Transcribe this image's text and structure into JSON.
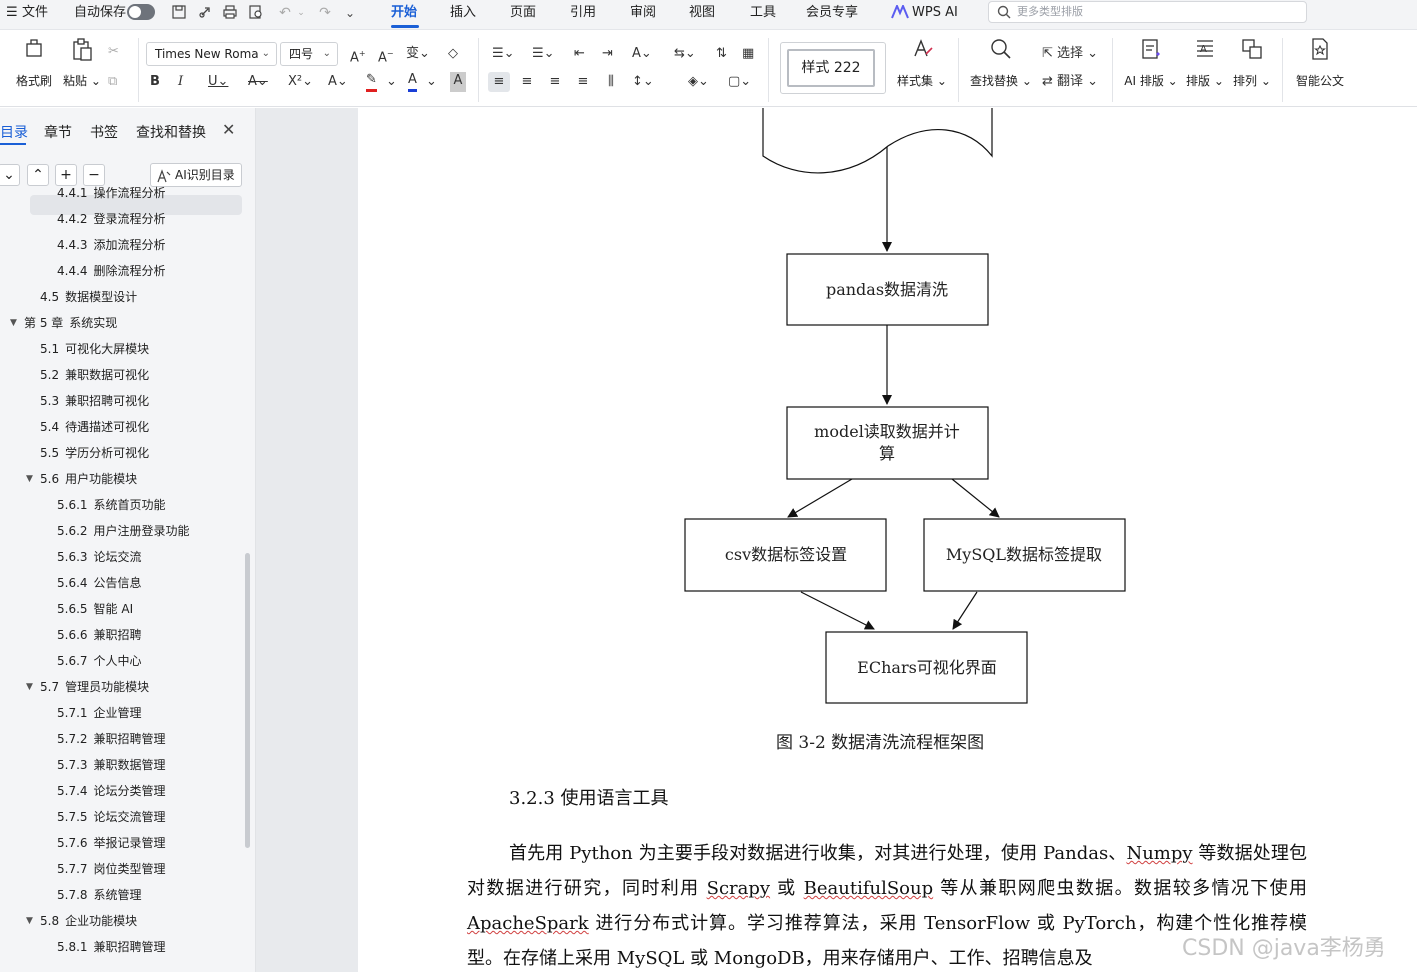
{
  "menubar": {
    "menu_label": "文件",
    "autosave_label": "自动保存",
    "tabs": [
      "开始",
      "插入",
      "页面",
      "引用",
      "审阅",
      "视图",
      "工具",
      "会员专享"
    ],
    "wps_ai": "WPS AI",
    "search_placeholder": "更多类型排版"
  },
  "ribbon": {
    "format_painter": "格式刷",
    "paste": "粘贴",
    "font_name": "Times New Roma",
    "font_size": "四号",
    "style_name": "样式 222",
    "styles_set": "样式集",
    "find_replace": "查找替换",
    "select": "选择",
    "translate": "翻译",
    "ai_layout": "AI 排版",
    "layout": "排版",
    "arrange": "排列",
    "smart_doc": "智能公文"
  },
  "nav": {
    "tabs": [
      "目录",
      "章节",
      "书签",
      "查找和替换"
    ],
    "ai_toc_button": "AI识别目录",
    "items": [
      {
        "num": "4.4.1",
        "label": "操作流程分析"
      },
      {
        "num": "4.4.2",
        "label": "登录流程分析"
      },
      {
        "num": "4.4.3",
        "label": "添加流程分析"
      },
      {
        "num": "4.4.4",
        "label": "删除流程分析"
      },
      {
        "num": "4.5",
        "label": "数据模型设计"
      },
      {
        "num": "第 5 章",
        "label": "系统实现"
      },
      {
        "num": "5.1",
        "label": "可视化大屏模块"
      },
      {
        "num": "5.2",
        "label": "兼职数据可视化"
      },
      {
        "num": "5.3",
        "label": "兼职招聘可视化"
      },
      {
        "num": "5.4",
        "label": "待遇描述可视化"
      },
      {
        "num": "5.5",
        "label": "学历分析可视化"
      },
      {
        "num": "5.6",
        "label": "用户功能模块"
      },
      {
        "num": "5.6.1",
        "label": "系统首页功能"
      },
      {
        "num": "5.6.2",
        "label": "用户注册登录功能"
      },
      {
        "num": "5.6.3",
        "label": "论坛交流"
      },
      {
        "num": "5.6.4",
        "label": "公告信息"
      },
      {
        "num": "5.6.5",
        "label": "智能 AI"
      },
      {
        "num": "5.6.6",
        "label": "兼职招聘"
      },
      {
        "num": "5.6.7",
        "label": "个人中心"
      },
      {
        "num": "5.7",
        "label": "管理员功能模块"
      },
      {
        "num": "5.7.1",
        "label": "企业管理"
      },
      {
        "num": "5.7.2",
        "label": "兼职招聘管理"
      },
      {
        "num": "5.7.3",
        "label": "兼职数据管理"
      },
      {
        "num": "5.7.4",
        "label": "论坛分类管理"
      },
      {
        "num": "5.7.5",
        "label": "论坛交流管理"
      },
      {
        "num": "5.7.6",
        "label": "举报记录管理"
      },
      {
        "num": "5.7.7",
        "label": "岗位类型管理"
      },
      {
        "num": "5.7.8",
        "label": "系统管理"
      },
      {
        "num": "5.8",
        "label": "企业功能模块"
      },
      {
        "num": "5.8.1",
        "label": "兼职招聘管理"
      }
    ]
  },
  "document": {
    "flowchart": {
      "nodes": [
        "pandas数据清洗",
        "model读取数据并计",
        "算",
        "csv数据标签设置",
        "MySQL数据标签提取",
        "EChars可视化界面"
      ]
    },
    "caption": "图 3-2  数据清洗流程框架图",
    "heading": "3.2.3  使用语言工具",
    "paragraph": {
      "p1": "首先用 Python 为主要手段对数据进行收集，对其进行处理，使用 Pandas、",
      "numpy": "Numpy",
      "p2": " 等数据处理包对数据进行研究，同时利用 ",
      "scrapy": "Scrapy",
      "p3": " 或 ",
      "bs": "BeautifulSoup",
      "p4": " 等从兼职网爬虫数据。数据较多情况下使用 ",
      "spark": "ApacheSpark",
      "p5": " 进行分布式计算。学习推荐算法，采用 TensorFlow 或 PyTorch，构建个性化推荐模型。在存储上采用 MySQL 或 MongoDB，用来存储用户、工作、招聘信息及"
    },
    "watermark": "CSDN @java李杨勇"
  }
}
